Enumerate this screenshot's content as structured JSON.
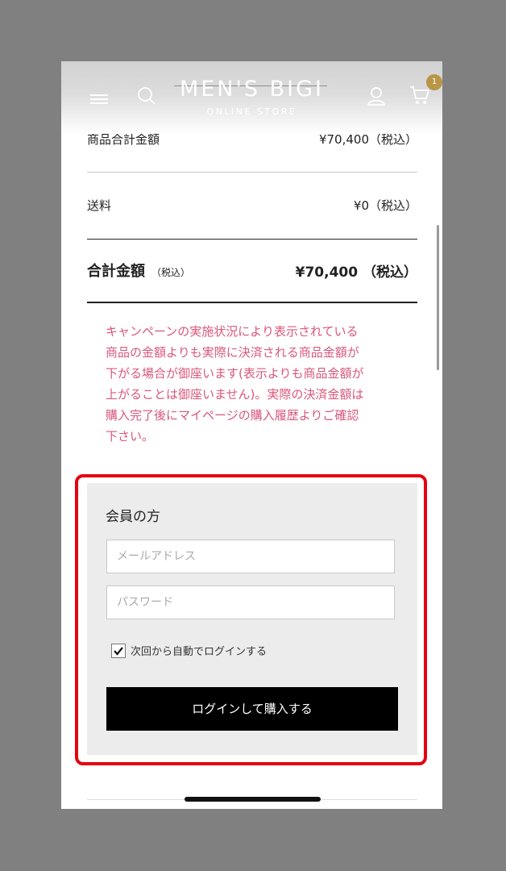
{
  "header": {
    "logo_title": "MEN'S BIGI",
    "logo_subtitle": "ONLINE STORE",
    "cart_count": "1"
  },
  "summary": {
    "subtotal_label": "商品合計金額",
    "subtotal_value": "¥70,400（税込）",
    "shipping_label": "送料",
    "shipping_value": "¥0（税込）",
    "total_label": "合計金額",
    "total_tax_note": "（税込）",
    "total_value": "¥70,400 （税込）"
  },
  "notice": "キャンペーンの実施状況により表示されている\n商品の金額よりも実際に決済される商品金額が\n下がる場合が御座います(表示よりも商品金額が\n上がることは御座いません)。実際の決済金額は\n購入完了後にマイページの購入履歴よりご確認\n下さい。",
  "login": {
    "title": "会員の方",
    "email_placeholder": "メールアドレス",
    "password_placeholder": "パスワード",
    "remember_label": "次回から自動でログインする",
    "remember_checked": true,
    "submit_label": "ログインして購入する"
  },
  "colors": {
    "notice": "#d9577a",
    "highlight": "#e50012",
    "badge": "#b89646"
  }
}
